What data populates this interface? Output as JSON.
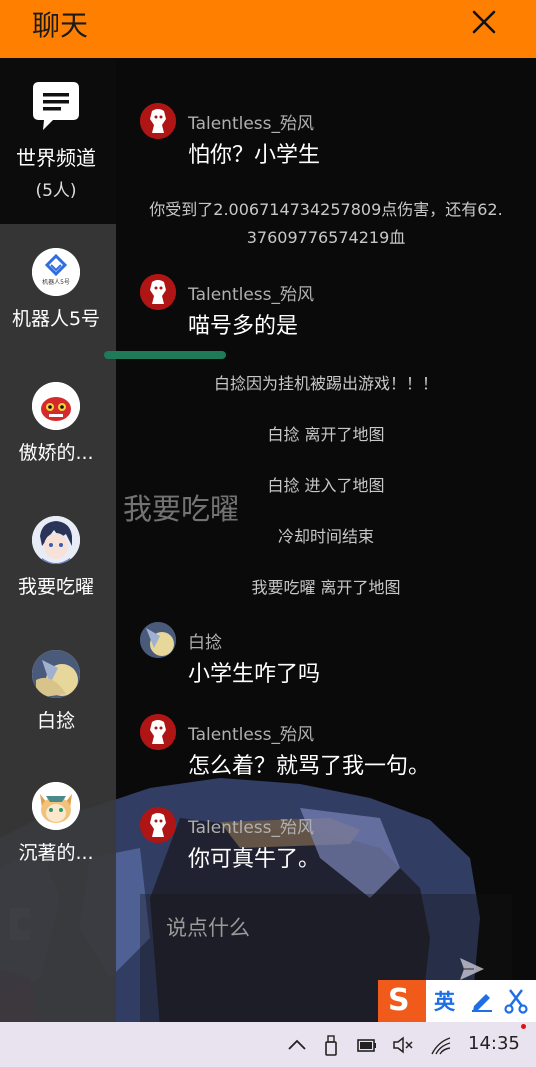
{
  "header": {
    "title": "聊天",
    "close_icon": "close-icon"
  },
  "sidebar": {
    "world_channel": {
      "label": "世界频道",
      "count": "(5人)",
      "icon": "chat-bubble-icon"
    },
    "contacts": [
      {
        "name": "机器人5号",
        "avatar_text": "机器人5号"
      },
      {
        "name": "傲娇的..."
      },
      {
        "name": "我要吃曜"
      },
      {
        "name": "白捻"
      },
      {
        "name": "沉著的..."
      }
    ]
  },
  "messages": [
    {
      "kind": "user",
      "user": "Talentless_殆风",
      "text": "怕你？小学生"
    },
    {
      "kind": "system",
      "line1": "你受到了2.006714734257809点伤害，还有62.",
      "line2": "37609776574219血"
    },
    {
      "kind": "user",
      "user": "Talentless_殆风",
      "text": "喵号多的是"
    },
    {
      "kind": "system",
      "text": "白捻因为挂机被踢出游戏！！！"
    },
    {
      "kind": "system",
      "text": "白捻 离开了地图"
    },
    {
      "kind": "system",
      "text": "白捻 进入了地图"
    },
    {
      "kind": "system",
      "text": "冷却时间结束"
    },
    {
      "kind": "system",
      "text": "我要吃曜 离开了地图"
    },
    {
      "kind": "user",
      "user": "白捻",
      "text": "小学生咋了吗"
    },
    {
      "kind": "user",
      "user": "Talentless_殆风",
      "text": "怎么着？就骂了我一句。"
    },
    {
      "kind": "user",
      "user": "Talentless_殆风",
      "text": "你可真牛了。"
    }
  ],
  "overlay_name": "我要吃曜",
  "input": {
    "placeholder": "说点什么",
    "send_icon": "send-icon"
  },
  "ime": {
    "logo": "S",
    "lang": "英",
    "pen_icon": "pen-icon",
    "scissors_icon": "scissors-icon"
  },
  "taskbar": {
    "time": "14:35"
  },
  "colors": {
    "header": "#ff8000",
    "accent_green": "#1f7a5a",
    "ime_orange": "#f05a1a",
    "ime_blue": "#1e6ee6"
  }
}
